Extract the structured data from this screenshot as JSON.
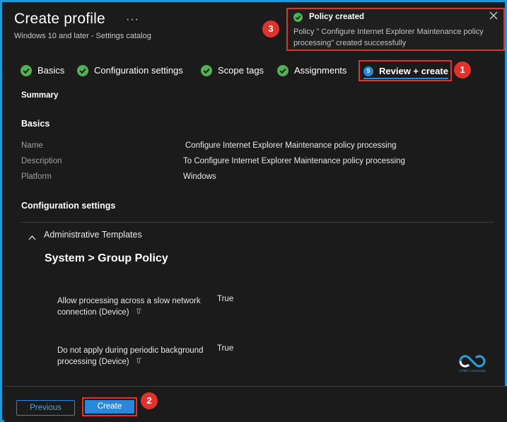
{
  "header": {
    "title": "Create profile",
    "more_label": "···",
    "subtitle": "Windows 10 and later - Settings catalog"
  },
  "toast": {
    "title": "Policy created",
    "message": "Policy \" Configure Internet Explorer Maintenance policy processing\" created successfully",
    "status_color": "#54b054",
    "close_icon": "close-icon"
  },
  "annotations": {
    "badge_1": "1",
    "badge_2": "2",
    "badge_3": "3",
    "highlight_color": "#e0312a"
  },
  "wizard": {
    "steps": [
      {
        "label": "Basics",
        "state": "complete",
        "icon": "checkmark-circle-icon"
      },
      {
        "label": "Configuration settings",
        "state": "complete",
        "icon": "checkmark-circle-icon"
      },
      {
        "label": "Scope tags",
        "state": "complete",
        "icon": "checkmark-circle-icon"
      },
      {
        "label": "Assignments",
        "state": "complete",
        "icon": "checkmark-circle-icon"
      },
      {
        "label": "Review + create",
        "state": "active",
        "number": "5"
      }
    ],
    "active_color": "#2b88d8",
    "complete_color": "#54b054"
  },
  "summary": {
    "heading": "Summary",
    "basics_heading": "Basics",
    "fields": [
      {
        "label": "Name",
        "value": "Configure Internet Explorer Maintenance policy processing"
      },
      {
        "label": "Description",
        "value": "To  Configure Internet Explorer Maintenance policy processing"
      },
      {
        "label": "Platform",
        "value": "Windows"
      }
    ]
  },
  "config": {
    "heading": "Configuration settings",
    "category": "Administrative Templates",
    "group_title": "System > Group Policy",
    "settings": [
      {
        "name": "Allow processing across a slow network connection (Device)",
        "value": "True"
      },
      {
        "name": "Do not apply during periodic background processing (Device)",
        "value": "True"
      }
    ]
  },
  "watermark": {
    "text": "HTMD Community"
  },
  "footer": {
    "previous_label": "Previous",
    "create_label": "Create"
  }
}
